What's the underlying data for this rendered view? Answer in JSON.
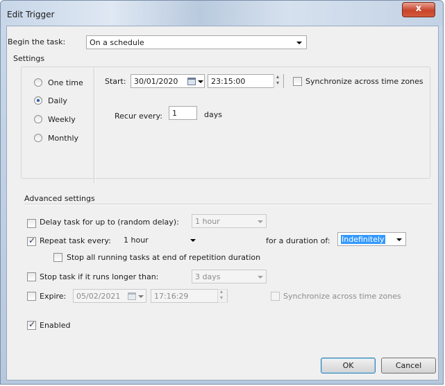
{
  "window": {
    "title": "Edit Trigger",
    "close_label": "x"
  },
  "begin": {
    "label": "Begin the task:",
    "value": "On a schedule"
  },
  "settings": {
    "group_label": "Settings",
    "radios": [
      {
        "label": "One time",
        "selected": false
      },
      {
        "label": "Daily",
        "selected": true
      },
      {
        "label": "Weekly",
        "selected": false
      },
      {
        "label": "Monthly",
        "selected": false
      }
    ],
    "start_label": "Start:",
    "start_date": "30/01/2020",
    "start_time": "23:15:00",
    "sync_label": "Synchronize across time zones",
    "recur_label": "Recur every:",
    "recur_value": "1",
    "recur_unit": "days"
  },
  "advanced": {
    "group_label": "Advanced settings",
    "delay_label": "Delay task for up to (random delay):",
    "delay_value": "1 hour",
    "repeat_label": "Repeat task every:",
    "repeat_value": "1 hour",
    "duration_label": "for a duration of:",
    "duration_value": "Indefinitely",
    "stop_all_label": "Stop all running tasks at end of repetition duration",
    "stop_longer_label": "Stop task if it runs longer than:",
    "stop_longer_value": "3 days",
    "expire_label": "Expire:",
    "expire_date": "05/02/2021",
    "expire_time": "17:16:29",
    "expire_sync_label": "Synchronize across time zones",
    "enabled_label": "Enabled"
  },
  "buttons": {
    "ok": "OK",
    "cancel": "Cancel"
  },
  "colors": {
    "accent_selection": "#3399ff",
    "close_button": "#c7442a"
  }
}
